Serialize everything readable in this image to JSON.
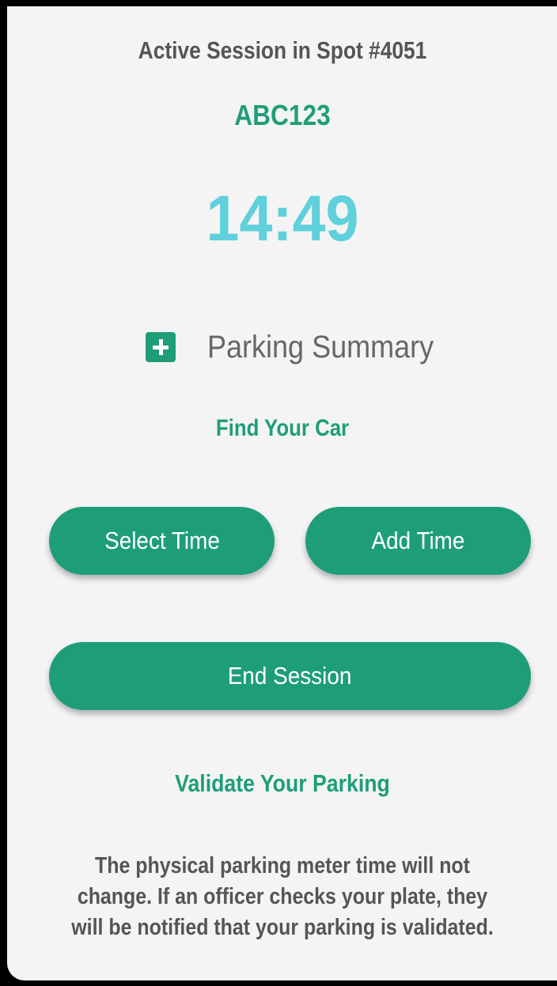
{
  "session": {
    "title": "Active Session in Spot #4051",
    "plate": "ABC123",
    "timer": "14:49"
  },
  "summary": {
    "icon": "plus-square-icon",
    "label": "Parking Summary"
  },
  "links": {
    "find_car": "Find Your Car",
    "validate": "Validate Your Parking"
  },
  "buttons": {
    "select_time": "Select Time",
    "add_time": "Add Time",
    "end_session": "End Session"
  },
  "note": {
    "lines": [
      "The physical parking meter time will not",
      "change. If an officer checks your plate, they",
      "will be notified that your parking is validated."
    ]
  },
  "colors": {
    "accent": "#1e9e78",
    "timer": "#5fd0dc",
    "text": "#555555",
    "background": "#f4f4f4"
  }
}
